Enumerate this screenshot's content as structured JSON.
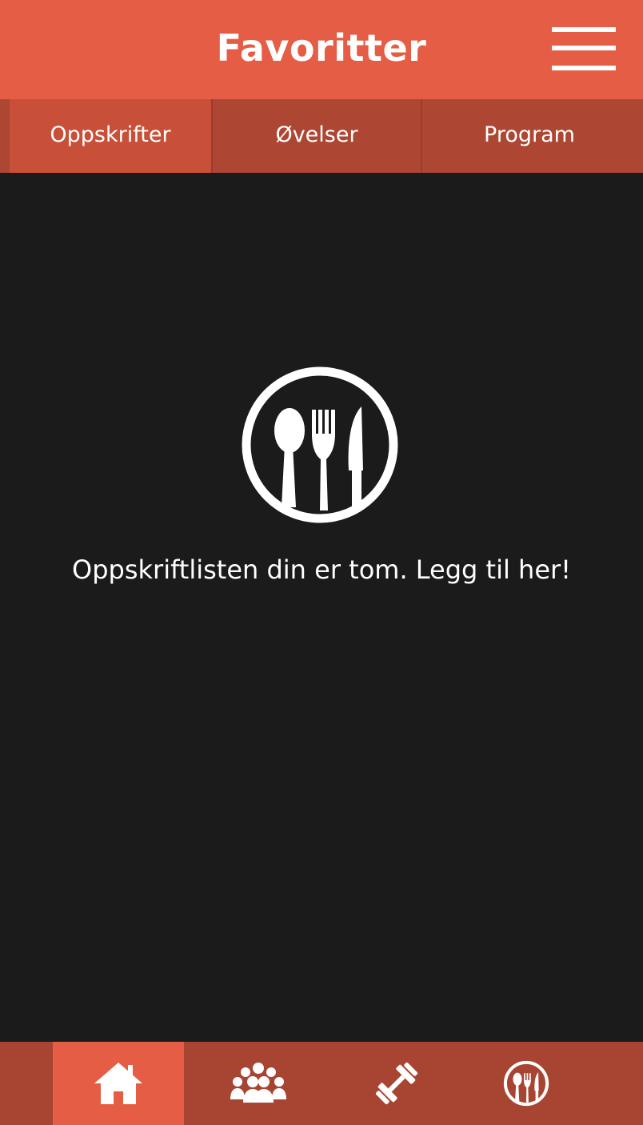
{
  "header": {
    "title": "Favoritter",
    "menu_icon": "hamburger-menu-icon"
  },
  "tabs": [
    {
      "label": "Oppskrifter",
      "active": true
    },
    {
      "label": "Øvelser",
      "active": false
    },
    {
      "label": "Program",
      "active": false
    }
  ],
  "empty_state": {
    "icon": "cutlery-plate-icon",
    "message": "Oppskriftlisten din er tom. Legg til her!"
  },
  "bottom_nav": [
    {
      "icon": "home-icon",
      "active": true
    },
    {
      "icon": "group-icon",
      "active": false
    },
    {
      "icon": "dumbbell-icon",
      "active": false
    },
    {
      "icon": "cutlery-icon",
      "active": false
    }
  ],
  "colors": {
    "accent": "#e45d44",
    "tab_bar": "#ad4734",
    "tab_active": "#c85039",
    "nav_bar": "#a84532",
    "background": "#1b1b1b",
    "text": "#ffffff"
  }
}
